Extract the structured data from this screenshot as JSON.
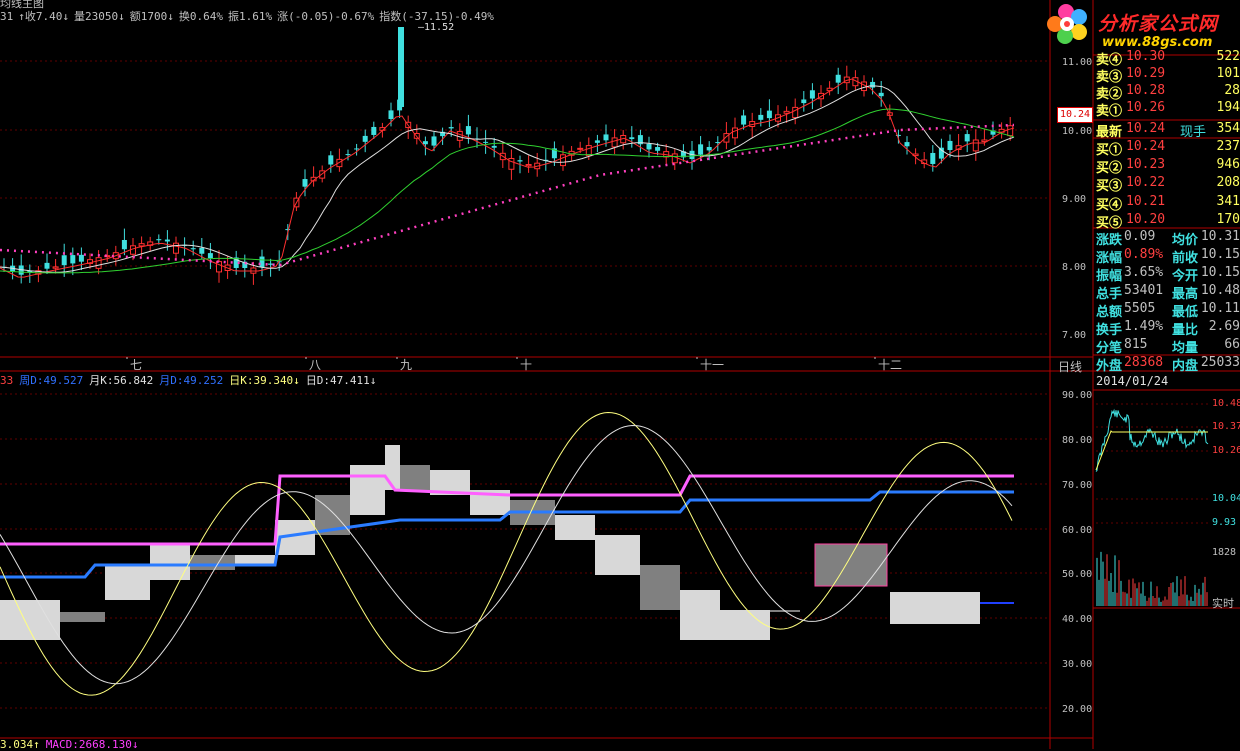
{
  "header": {
    "title_fragment": "均线主图",
    "info": [
      {
        "text": "31",
        "color": "#c0c0c0"
      },
      {
        "text": "↑收7.40↓",
        "color": "#c0c0c0"
      },
      {
        "text": "量23050↓",
        "color": "#c0c0c0"
      },
      {
        "text": "额1700↓",
        "color": "#c0c0c0"
      },
      {
        "text": "换0.64%",
        "color": "#c0c0c0"
      },
      {
        "text": "振1.61%",
        "color": "#c0c0c0"
      },
      {
        "text": "涨(-0.05)-0.67%",
        "color": "#c0c0c0"
      },
      {
        "text": "指数(-37.15)-0.49%",
        "color": "#c0c0c0"
      }
    ]
  },
  "kdj": {
    "items": [
      {
        "text": "33",
        "color": "#ff4040"
      },
      {
        "text": "周D:49.527",
        "color": "#3070ff"
      },
      {
        "text": "月K:56.842",
        "color": "#e0e0e0"
      },
      {
        "text": "月D:49.252",
        "color": "#3070ff"
      },
      {
        "text": "日K:39.340↓",
        "color": "#ffff80"
      },
      {
        "text": "日D:47.411↓",
        "color": "#e0e0e0"
      }
    ]
  },
  "macd": {
    "items": [
      {
        "text": "3.034↑",
        "color": "#ffff80"
      },
      {
        "text": "MACD:2668.130↓",
        "color": "#ff40ff"
      }
    ]
  },
  "logo": {
    "name": "分析家公式网",
    "url": "www.88gs.com"
  },
  "price_axis": [
    "11.00",
    "10.00",
    "9.00",
    "8.00",
    "7.00"
  ],
  "last_price_tag": "10.24",
  "peak_label": "11.52",
  "months": [
    "七",
    "八",
    "九",
    "十",
    "十一",
    "十二"
  ],
  "period_button": "日线",
  "kdj_axis": [
    "90.00",
    "80.00",
    "70.00",
    "60.00",
    "50.00",
    "40.00",
    "30.00",
    "20.00"
  ],
  "order_book": {
    "sell": [
      {
        "label": "卖④",
        "price": "10.30",
        "vol": "522"
      },
      {
        "label": "卖③",
        "price": "10.29",
        "vol": "101"
      },
      {
        "label": "卖②",
        "price": "10.28",
        "vol": "28"
      },
      {
        "label": "卖①",
        "price": "10.26",
        "vol": "194"
      }
    ],
    "latest": {
      "label": "最新",
      "price": "10.24",
      "label2": "现手",
      "vol": "354"
    },
    "buy": [
      {
        "label": "买①",
        "price": "10.24",
        "vol": "237"
      },
      {
        "label": "买②",
        "price": "10.23",
        "vol": "946"
      },
      {
        "label": "买③",
        "price": "10.22",
        "vol": "208"
      },
      {
        "label": "买④",
        "price": "10.21",
        "vol": "341"
      },
      {
        "label": "买⑤",
        "price": "10.20",
        "vol": "170"
      }
    ]
  },
  "stats": [
    {
      "l1": "涨跌",
      "v1": "0.09",
      "l2": "均价",
      "v2": "10.31"
    },
    {
      "l1": "涨幅",
      "v1": "0.89%",
      "l2": "前收",
      "v2": "10.15"
    },
    {
      "l1": "振幅",
      "v1": "3.65%",
      "l2": "今开",
      "v2": "10.15"
    },
    {
      "l1": "总手",
      "v1": "53401",
      "l2": "最高",
      "v2": "10.48"
    },
    {
      "l1": "总额",
      "v1": "5505",
      "l2": "最低",
      "v2": "10.11"
    },
    {
      "l1": "换手",
      "v1": "1.49%",
      "l2": "量比",
      "v2": "2.69"
    },
    {
      "l1": "分笔",
      "v1": "815",
      "l2": "均量",
      "v2": "66"
    },
    {
      "l1": "外盘",
      "v1": "28368",
      "l2": "内盘",
      "v2": "25033"
    }
  ],
  "intraday": {
    "date": "2014/01/24",
    "axis": [
      "10.48",
      "10.37",
      "10.26",
      "10.04",
      "9.93"
    ],
    "vol_label": "1828",
    "realtime_label": "实时"
  },
  "colors": {
    "up": "#ff3030",
    "down": "#40e0e0",
    "ma_long": "#30d030",
    "ma_mid": "#e0e0e0",
    "ma_short": "#ff3030",
    "trend": "#ff40c0"
  }
}
